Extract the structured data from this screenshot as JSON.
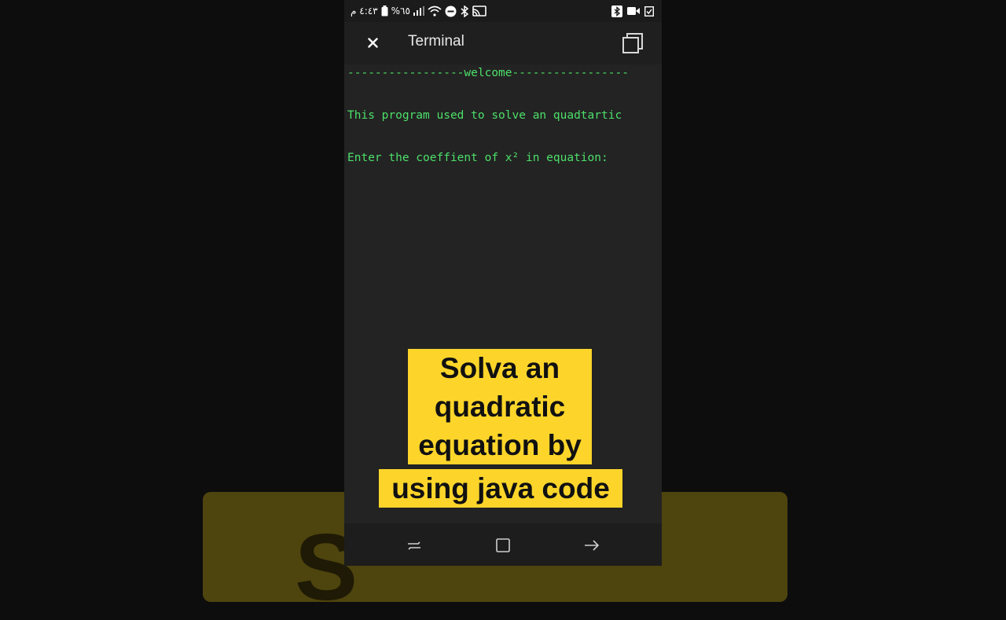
{
  "status_bar": {
    "time": "٤:٤٣ م",
    "battery": "%٦٥"
  },
  "app_bar": {
    "title": "Terminal"
  },
  "terminal": {
    "lines": [
      "-----------------welcome-----------------",
      "This program used to solve an quadtartic",
      "Enter the coeffient of x² in equation:"
    ]
  },
  "caption": {
    "lines": [
      "Solva an",
      "quadratic",
      "equation by",
      "using java code"
    ],
    "background_color": "#fdd52a"
  },
  "background": {
    "blur_text": "S"
  },
  "colors": {
    "terminal_text": "#4ce06a",
    "terminal_bg": "#232323"
  },
  "icons": {
    "close": "close-icon",
    "copy": "copy-icon",
    "nav_recents": "recents-icon",
    "nav_home": "home-icon",
    "nav_back": "back-icon"
  }
}
